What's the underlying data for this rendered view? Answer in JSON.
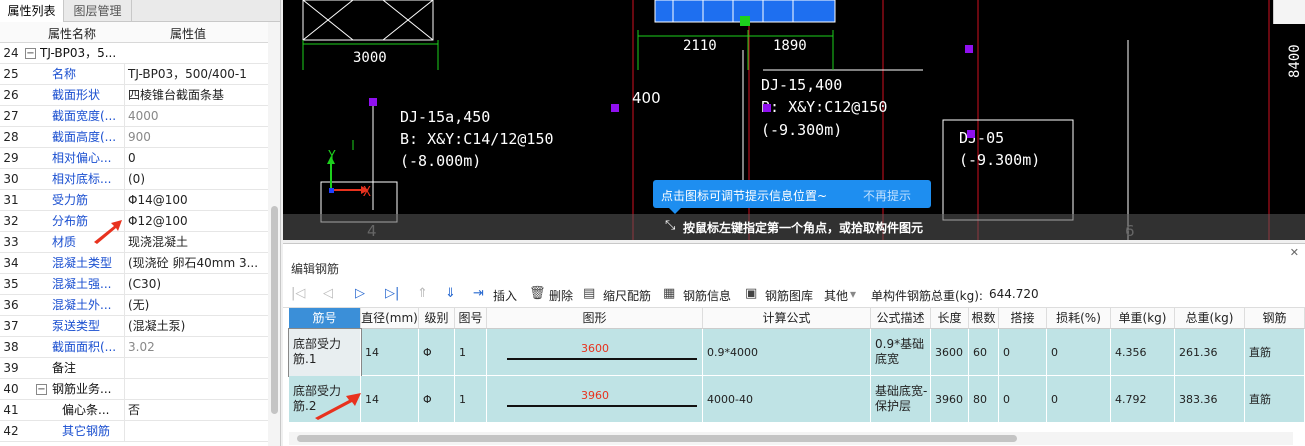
{
  "left_panel": {
    "tabs": [
      "属性列表",
      "图层管理"
    ],
    "header": {
      "name": "属性名称",
      "value": "属性值"
    },
    "rows": [
      {
        "n": "24",
        "name": "TJ-BP03，5...",
        "value": "",
        "style": "black",
        "expand": "−"
      },
      {
        "n": "25",
        "name": "名称",
        "value": "TJ-BP03，500/400-1",
        "style": "blue"
      },
      {
        "n": "26",
        "name": "截面形状",
        "value": "四棱锥台截面条基",
        "style": "blue"
      },
      {
        "n": "27",
        "name": "截面宽度(...",
        "value": "4000",
        "style": "blue",
        "gray": true
      },
      {
        "n": "28",
        "name": "截面高度(...",
        "value": "900",
        "style": "blue",
        "gray": true
      },
      {
        "n": "29",
        "name": "相对偏心...",
        "value": "0",
        "style": "blue"
      },
      {
        "n": "30",
        "name": "相对底标...",
        "value": "(0)",
        "style": "blue"
      },
      {
        "n": "31",
        "name": "受力筋",
        "value": "Φ14@100",
        "style": "blue"
      },
      {
        "n": "32",
        "name": "分布筋",
        "value": "Φ12@100",
        "style": "blue"
      },
      {
        "n": "33",
        "name": "材质",
        "value": "现浇混凝土",
        "style": "blue"
      },
      {
        "n": "34",
        "name": "混凝土类型",
        "value": "(现浇砼 卵石40mm 3...",
        "style": "blue"
      },
      {
        "n": "35",
        "name": "混凝土强...",
        "value": "(C30)",
        "style": "blue"
      },
      {
        "n": "36",
        "name": "混凝土外...",
        "value": "(无)",
        "style": "blue"
      },
      {
        "n": "37",
        "name": "泵送类型",
        "value": "(混凝土泵)",
        "style": "blue"
      },
      {
        "n": "38",
        "name": "截面面积(...",
        "value": "3.02",
        "style": "blue",
        "gray": true
      },
      {
        "n": "39",
        "name": "备注",
        "value": "",
        "style": "black"
      },
      {
        "n": "40",
        "name": "钢筋业务...",
        "value": "",
        "style": "black",
        "expand": "−"
      },
      {
        "n": "41",
        "name": "偏心条...",
        "value": "否",
        "style": "black",
        "indent": true
      },
      {
        "n": "42",
        "name": "其它钢筋",
        "value": "",
        "style": "blue",
        "indent": true
      }
    ]
  },
  "cad": {
    "labels": [
      "3000",
      "2110",
      "1890",
      "400",
      "8400",
      "4",
      "6",
      "Y",
      "X"
    ],
    "annotations": [
      {
        "l1": "DJ-15a,450",
        "l2": "B: X&Y:C14/12@150",
        "l3": "(-8.000m)"
      },
      {
        "l1": "DJ-15,400",
        "l2": "B: X&Y:C12@150",
        "l3": "(-9.300m)"
      },
      {
        "l1": "DJ-05",
        "l2": "",
        "l3": "(-9.300m)"
      }
    ],
    "tip_text": "点击图标可调节提示信息位置~",
    "tip_dismiss": "不再提示",
    "status": "按鼠标左键指定第一个角点，或拾取构件图元"
  },
  "rebar_panel": {
    "title": "编辑钢筋",
    "toolbar": {
      "insert": "插入",
      "delete": "删除",
      "scale": "缩尺配筋",
      "info": "钢筋信息",
      "lib": "钢筋图库",
      "other": "其他",
      "total_label": "单构件钢筋总重(kg):",
      "total_value": "644.720"
    },
    "columns": [
      "筋号",
      "直径(mm)",
      "级别",
      "图号",
      "图形",
      "计算公式",
      "公式描述",
      "长度",
      "根数",
      "搭接",
      "损耗(%)",
      "单重(kg)",
      "总重(kg)",
      "钢筋"
    ],
    "rows": [
      {
        "c": [
          "底部受力筋.1",
          "14",
          "Φ",
          "1",
          "3600",
          "0.9*4000",
          "0.9*基础底宽",
          "3600",
          "60",
          "0",
          "0",
          "4.356",
          "261.36",
          "直筋"
        ]
      },
      {
        "c": [
          "底部受力筋.2",
          "14",
          "Φ",
          "1",
          "3960",
          "4000-40",
          "基础底宽-保护层",
          "3960",
          "80",
          "0",
          "0",
          "4.792",
          "383.36",
          "直筋"
        ]
      }
    ]
  }
}
